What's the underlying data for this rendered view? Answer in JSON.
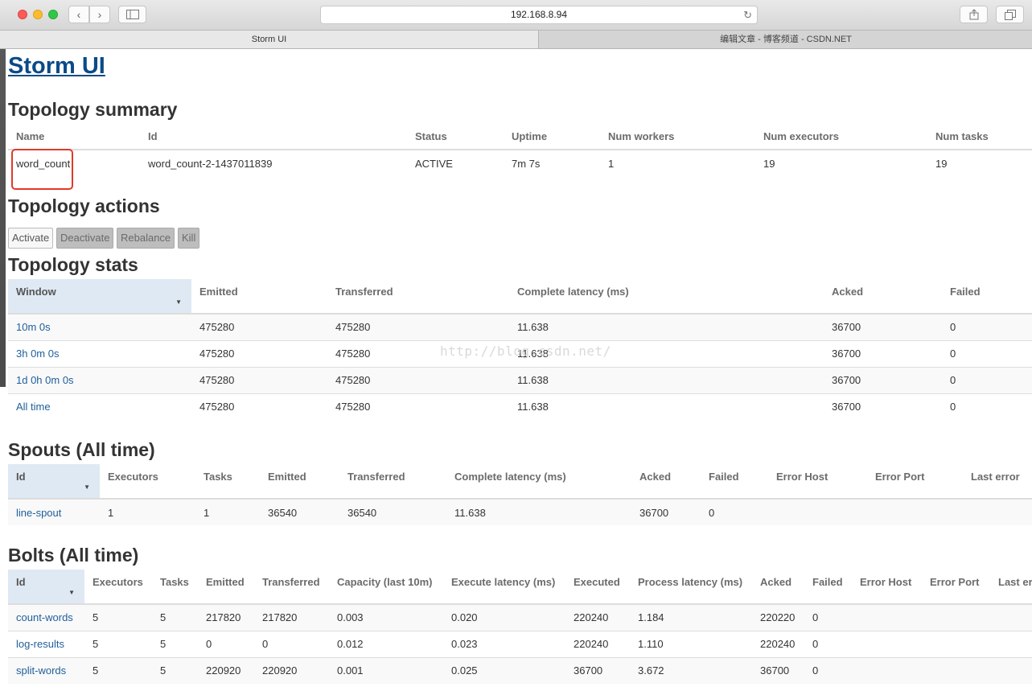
{
  "browser": {
    "url": "192.168.8.94",
    "tabs": [
      "Storm UI",
      "编辑文章 - 博客频道 - CSDN.NET"
    ],
    "back_icon": "‹",
    "forward_icon": "›",
    "reload_icon": "↻"
  },
  "page_title": "Storm UI",
  "topology_summary": {
    "heading": "Topology summary",
    "columns": [
      "Name",
      "Id",
      "Status",
      "Uptime",
      "Num workers",
      "Num executors",
      "Num tasks"
    ],
    "rows": [
      [
        "word_count",
        "word_count-2-1437011839",
        "ACTIVE",
        "7m 7s",
        "1",
        "19",
        "19"
      ]
    ]
  },
  "topology_actions": {
    "heading": "Topology actions",
    "buttons": [
      "Activate",
      "Deactivate",
      "Rebalance",
      "Kill"
    ]
  },
  "topology_stats": {
    "heading": "Topology stats",
    "columns": [
      "Window",
      "Emitted",
      "Transferred",
      "Complete latency (ms)",
      "Acked",
      "Failed"
    ],
    "rows": [
      [
        "10m 0s",
        "475280",
        "475280",
        "11.638",
        "36700",
        "0"
      ],
      [
        "3h 0m 0s",
        "475280",
        "475280",
        "11.638",
        "36700",
        "0"
      ],
      [
        "1d 0h 0m 0s",
        "475280",
        "475280",
        "11.638",
        "36700",
        "0"
      ],
      [
        "All time",
        "475280",
        "475280",
        "11.638",
        "36700",
        "0"
      ]
    ]
  },
  "spouts": {
    "heading": "Spouts (All time)",
    "columns": [
      "Id",
      "Executors",
      "Tasks",
      "Emitted",
      "Transferred",
      "Complete latency (ms)",
      "Acked",
      "Failed",
      "Error Host",
      "Error Port",
      "Last error"
    ],
    "rows": [
      [
        "line-spout",
        "1",
        "1",
        "36540",
        "36540",
        "11.638",
        "36700",
        "0",
        "",
        "",
        ""
      ]
    ]
  },
  "bolts": {
    "heading": "Bolts (All time)",
    "columns": [
      "Id",
      "Executors",
      "Tasks",
      "Emitted",
      "Transferred",
      "Capacity (last 10m)",
      "Execute latency (ms)",
      "Executed",
      "Process latency (ms)",
      "Acked",
      "Failed",
      "Error Host",
      "Error Port",
      "Last er"
    ],
    "rows": [
      [
        "count-words",
        "5",
        "5",
        "217820",
        "217820",
        "0.003",
        "0.020",
        "220240",
        "1.184",
        "220220",
        "0",
        "",
        "",
        ""
      ],
      [
        "log-results",
        "5",
        "5",
        "0",
        "0",
        "0.012",
        "0.023",
        "220240",
        "1.110",
        "220240",
        "0",
        "",
        "",
        ""
      ],
      [
        "split-words",
        "5",
        "5",
        "220920",
        "220920",
        "0.001",
        "0.025",
        "36700",
        "3.672",
        "36700",
        "0",
        "",
        "",
        ""
      ]
    ]
  },
  "watermark": "http://blog.csdn.net/"
}
